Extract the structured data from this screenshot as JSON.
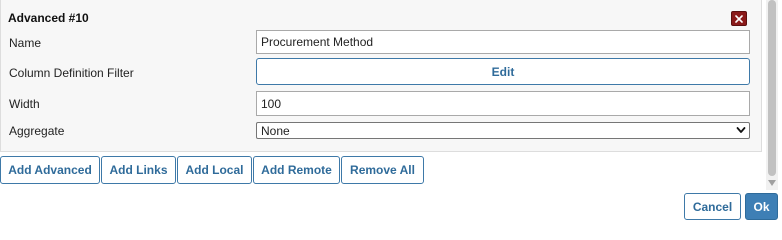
{
  "panel": {
    "title": "Advanced #10",
    "fields": {
      "name_label": "Name",
      "name_value": "Procurement Method",
      "filter_label": "Column Definition Filter",
      "filter_button": "Edit",
      "width_label": "Width",
      "width_value": "100",
      "aggregate_label": "Aggregate",
      "aggregate_selected": "None"
    }
  },
  "actions": {
    "add_advanced": "Add Advanced",
    "add_links": "Add Links",
    "add_local": "Add Local",
    "add_remote": "Add Remote",
    "remove_all": "Remove All"
  },
  "dialog": {
    "cancel": "Cancel",
    "ok": "Ok"
  },
  "icons": {
    "close": "close-icon",
    "dropdown": "chevron-down-icon",
    "scroll": "scroll-down-icon"
  },
  "colors": {
    "accent": "#2f6b9a",
    "close_bg": "#8b1a1a",
    "ok_bg": "#3e7fb5"
  }
}
